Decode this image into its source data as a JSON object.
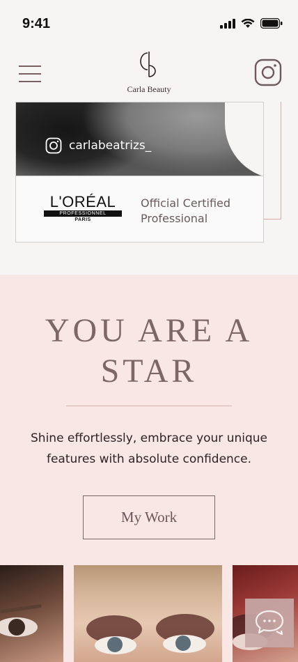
{
  "status_bar": {
    "time": "9:41"
  },
  "header": {
    "menu_icon": "hamburger-icon",
    "logo_monogram": "cb",
    "logo_name": "Carla Beauty",
    "instagram_icon": "instagram-icon"
  },
  "featured_card": {
    "instagram_handle": "carlabeatrizs_",
    "brand_logo": {
      "main": "L'ORÉAL",
      "sub": "PROFESSIONNEL",
      "city": "PARIS"
    },
    "certification": "Official Certified Professional"
  },
  "hero": {
    "title": "YOU ARE A STAR",
    "description": "Shine effortlessly, embrace your unique features with absolute confidence.",
    "button_label": "My Work"
  },
  "gallery": {
    "photos": [
      "makeup-photo-1",
      "makeup-photo-2",
      "makeup-photo-3"
    ]
  },
  "chat": {
    "icon": "chat-bubbles-icon"
  },
  "colors": {
    "accent": "#7d6666",
    "hero_bg": "#f9e7e6",
    "page_bg": "#f7f5f3",
    "divider": "#d8b3b2"
  }
}
